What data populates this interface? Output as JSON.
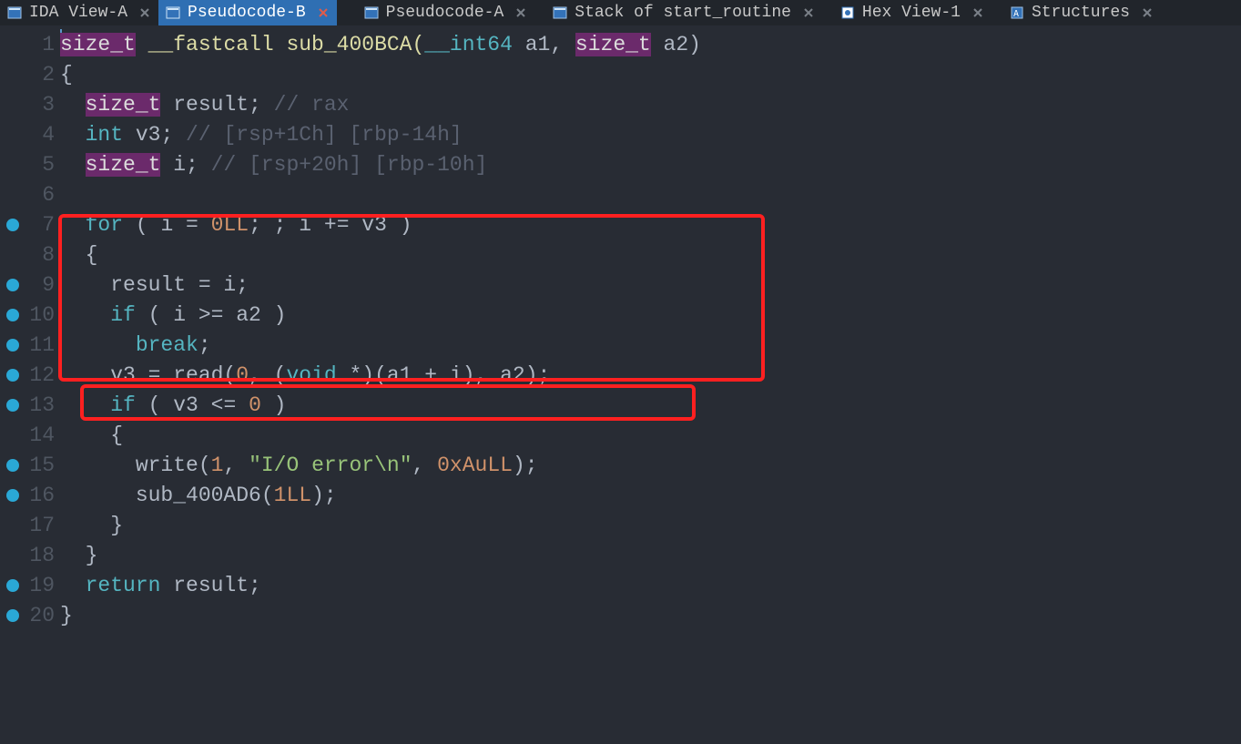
{
  "tabs": [
    {
      "label": "IDA View-A",
      "type": "view",
      "active": false
    },
    {
      "label": "Pseudocode-B",
      "type": "pseudo",
      "active": true
    },
    {
      "label": "Pseudocode-A",
      "type": "pseudo",
      "active": false
    },
    {
      "label": "Stack of start_routine",
      "type": "stack",
      "active": false
    },
    {
      "label": "Hex View-1",
      "type": "hex",
      "active": false
    },
    {
      "label": "Structures",
      "type": "struct",
      "active": false
    }
  ],
  "code": {
    "lines": [
      {
        "n": 1,
        "bp": false
      },
      {
        "n": 2,
        "bp": false
      },
      {
        "n": 3,
        "bp": false
      },
      {
        "n": 4,
        "bp": false
      },
      {
        "n": 5,
        "bp": false
      },
      {
        "n": 6,
        "bp": false
      },
      {
        "n": 7,
        "bp": true
      },
      {
        "n": 8,
        "bp": false
      },
      {
        "n": 9,
        "bp": true
      },
      {
        "n": 10,
        "bp": true
      },
      {
        "n": 11,
        "bp": true
      },
      {
        "n": 12,
        "bp": true
      },
      {
        "n": 13,
        "bp": true
      },
      {
        "n": 14,
        "bp": false
      },
      {
        "n": 15,
        "bp": true
      },
      {
        "n": 16,
        "bp": true
      },
      {
        "n": 17,
        "bp": false
      },
      {
        "n": 18,
        "bp": false
      },
      {
        "n": 19,
        "bp": true
      },
      {
        "n": 20,
        "bp": true
      }
    ],
    "tokens": {
      "l1": {
        "a": "size_t",
        "b": " __fastcall sub_400BCA(",
        "c": "__int64",
        "d": " a1, ",
        "e": "size_t",
        "f": " a2)"
      },
      "l2": "{",
      "l3": {
        "a": "  ",
        "b": "size_t",
        "c": " result; ",
        "d": "// rax"
      },
      "l4": {
        "a": "  ",
        "b": "int",
        "c": " v3; ",
        "d": "// [rsp+1Ch] [rbp-14h]"
      },
      "l5": {
        "a": "  ",
        "b": "size_t",
        "c": " i; ",
        "d": "// [rsp+20h] [rbp-10h]"
      },
      "l6": "",
      "l7": {
        "a": "  ",
        "b": "for",
        "c": " ( i = ",
        "d": "0LL",
        "e": "; ; i += v3 )"
      },
      "l8": "  {",
      "l9": "    result = i;",
      "l10": {
        "a": "    ",
        "b": "if",
        "c": " ( i >= a2 )"
      },
      "l11": {
        "a": "      ",
        "b": "break",
        "c": ";"
      },
      "l12": {
        "a": "    v3 = read(",
        "b": "0",
        "c": ", (",
        "d": "void",
        "e": " *)(a1 + i), a2);"
      },
      "l13": {
        "a": "    ",
        "b": "if",
        "c": " ( v3 <= ",
        "d": "0",
        "e": " )"
      },
      "l14": "    {",
      "l15": {
        "a": "      write(",
        "b": "1",
        "c": ", ",
        "d": "\"I/O error\\n\"",
        "e": ", ",
        "f": "0xAuLL",
        "g": ");"
      },
      "l16": {
        "a": "      sub_400AD6(",
        "b": "1LL",
        "c": ");"
      },
      "l17": "    }",
      "l18": "  }",
      "l19": {
        "a": "  ",
        "b": "return",
        "c": " result;"
      },
      "l20": "}"
    }
  }
}
